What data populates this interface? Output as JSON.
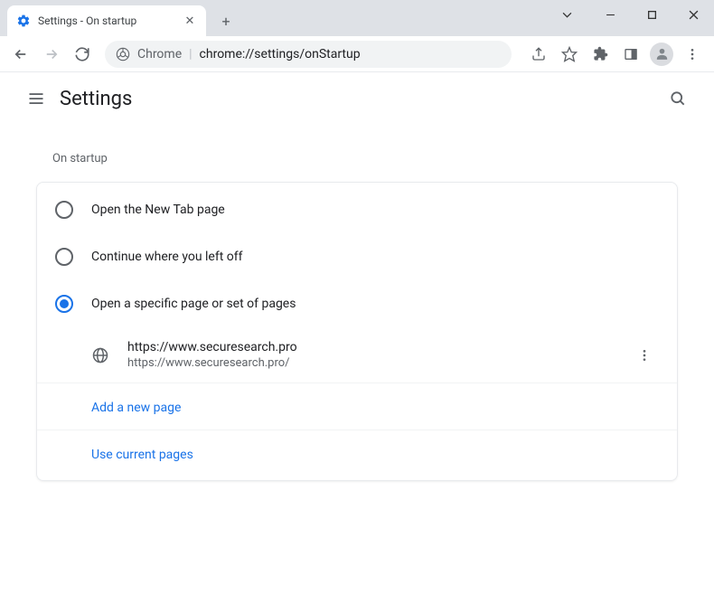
{
  "window": {
    "tab_title": "Settings - On startup"
  },
  "address": {
    "prefix": "Chrome",
    "url": "chrome://settings/onStartup"
  },
  "header": {
    "title": "Settings"
  },
  "section": {
    "title": "On startup",
    "options": [
      {
        "label": "Open the New Tab page",
        "selected": false
      },
      {
        "label": "Continue where you left off",
        "selected": false
      },
      {
        "label": "Open a specific page or set of pages",
        "selected": true
      }
    ],
    "pages": [
      {
        "name": "https://www.securesearch.pro",
        "url": "https://www.securesearch.pro/"
      }
    ],
    "add_page_label": "Add a new page",
    "use_current_label": "Use current pages"
  }
}
